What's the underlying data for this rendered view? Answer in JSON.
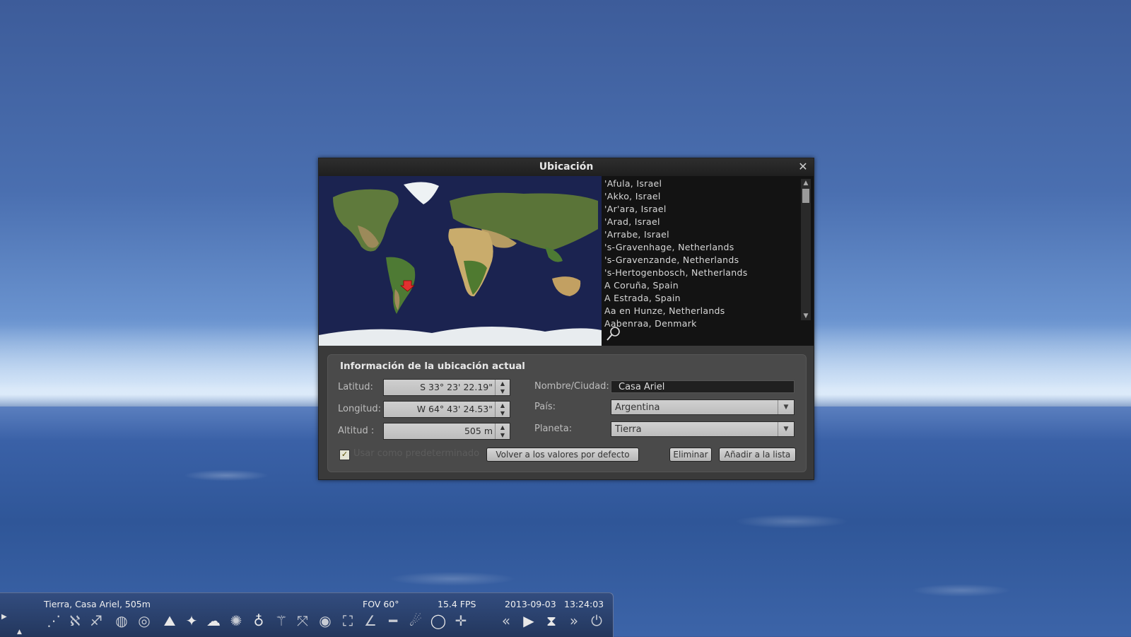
{
  "dialog": {
    "title": "Ubicación",
    "cities": [
      "'Afula, Israel",
      "'Akko, Israel",
      "'Ar'ara, Israel",
      "'Arad, Israel",
      "'Arrabe, Israel",
      "'s-Gravenhage, Netherlands",
      "'s-Gravenzande, Netherlands",
      "'s-Hertogenbosch, Netherlands",
      "A Coruña, Spain",
      "A Estrada, Spain",
      "Aa en Hunze, Netherlands",
      "Aabenraa, Denmark"
    ],
    "info": {
      "title": "Información de la ubicación actual",
      "latitude_label": "Latitud:",
      "latitude_value": "S 33° 23' 22.19\"",
      "longitude_label": "Longitud:",
      "longitude_value": "W 64° 43' 24.53\"",
      "altitude_label": "Altitud :",
      "altitude_value": "505 m",
      "name_label": "Nombre/Ciudad:",
      "name_value": "Casa Ariel",
      "country_label": "País:",
      "country_value": "Argentina",
      "planet_label": "Planeta:",
      "planet_value": "Tierra",
      "default_label": "Usar como predeterminado",
      "default_checked": true,
      "reset_button": "Volver a los valores por defecto",
      "delete_button": "Eliminar",
      "add_button": "Añadir a la lista"
    }
  },
  "statusbar": {
    "location": "Tierra, Casa Ariel, 505m",
    "fov": "FOV 60°",
    "fps": "15.4 FPS",
    "date": "2013-09-03",
    "time": "13:24:03"
  },
  "toolbar_icons": [
    "constellation-lines-icon",
    "constellation-labels-icon",
    "constellation-art-icon",
    "boundaries-icon",
    "equatorial-grid-icon",
    "azimuthal-grid-icon",
    "ground-icon",
    "cardinal-points-icon",
    "atmosphere-icon",
    "nebulae-icon",
    "planet-labels-icon",
    "equatorial-mount-icon",
    "center-object-icon",
    "night-mode-icon",
    "fullscreen-icon",
    "angle-measure-icon",
    "ruler-icon",
    "telescope-icon",
    "ocular-icon",
    "crosshair-icon",
    "rewind-icon",
    "play-icon",
    "now-icon",
    "fast-forward-icon",
    "quit-icon"
  ]
}
